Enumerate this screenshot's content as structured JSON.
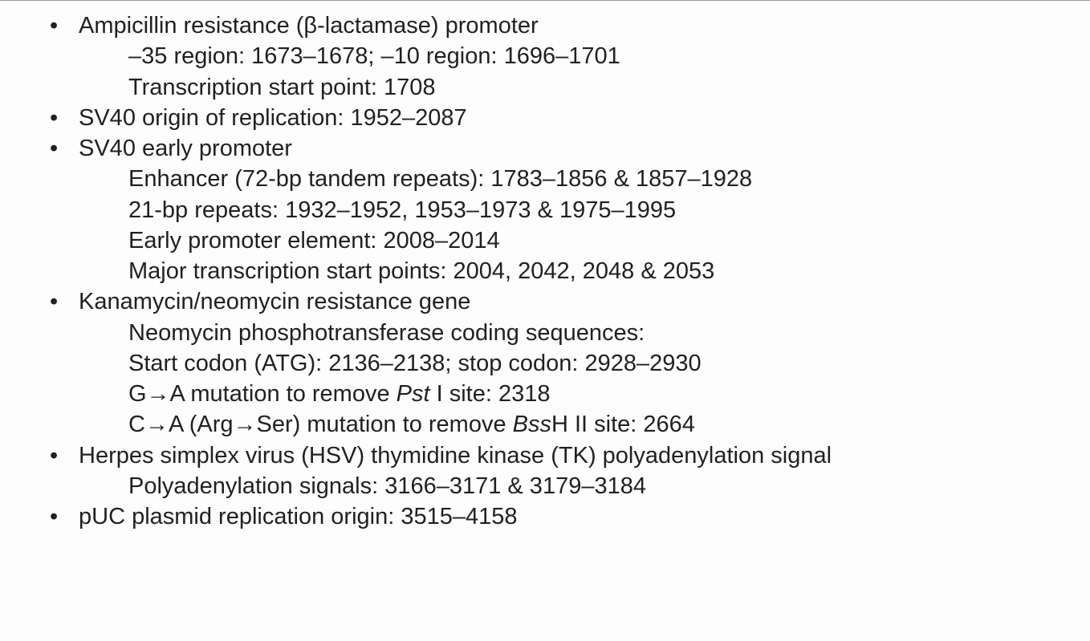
{
  "items": [
    {
      "head": "Ampicillin resistance (β-lactamase) promoter",
      "subs": [
        {
          "plain": "–35 region: 1673–1678;  –10 region: 1696–1701"
        },
        {
          "plain": "Transcription start point: 1708"
        }
      ]
    },
    {
      "head": "SV40 origin of replication: 1952–2087",
      "subs": []
    },
    {
      "head": "SV40 early promoter",
      "subs": [
        {
          "plain": "Enhancer (72-bp tandem repeats): 1783–1856 & 1857–1928"
        },
        {
          "plain": "21-bp repeats: 1932–1952, 1953–1973 & 1975–1995"
        },
        {
          "plain": "Early promoter element: 2008–2014"
        },
        {
          "plain": "Major transcription start points: 2004, 2042, 2048 & 2053"
        }
      ]
    },
    {
      "head": "Kanamycin/neomycin resistance gene",
      "subs": [
        {
          "plain": "Neomycin phosphotransferase coding sequences:"
        },
        {
          "plain": "Start codon (ATG): 2136–2138; stop codon: 2928–2930"
        },
        {
          "pre": "G→A mutation to remove ",
          "ital": "Pst",
          "post": " I site: 2318"
        },
        {
          "pre": "C→A (Arg→Ser) mutation to remove ",
          "ital": "Bss",
          "post": "H II site: 2664"
        }
      ]
    },
    {
      "head": "Herpes simplex virus (HSV) thymidine kinase (TK) polyadenylation signal",
      "subs": [
        {
          "plain": "Polyadenylation signals: 3166–3171 & 3179–3184"
        }
      ]
    },
    {
      "head": "pUC plasmid replication origin: 3515–4158",
      "subs": []
    }
  ]
}
